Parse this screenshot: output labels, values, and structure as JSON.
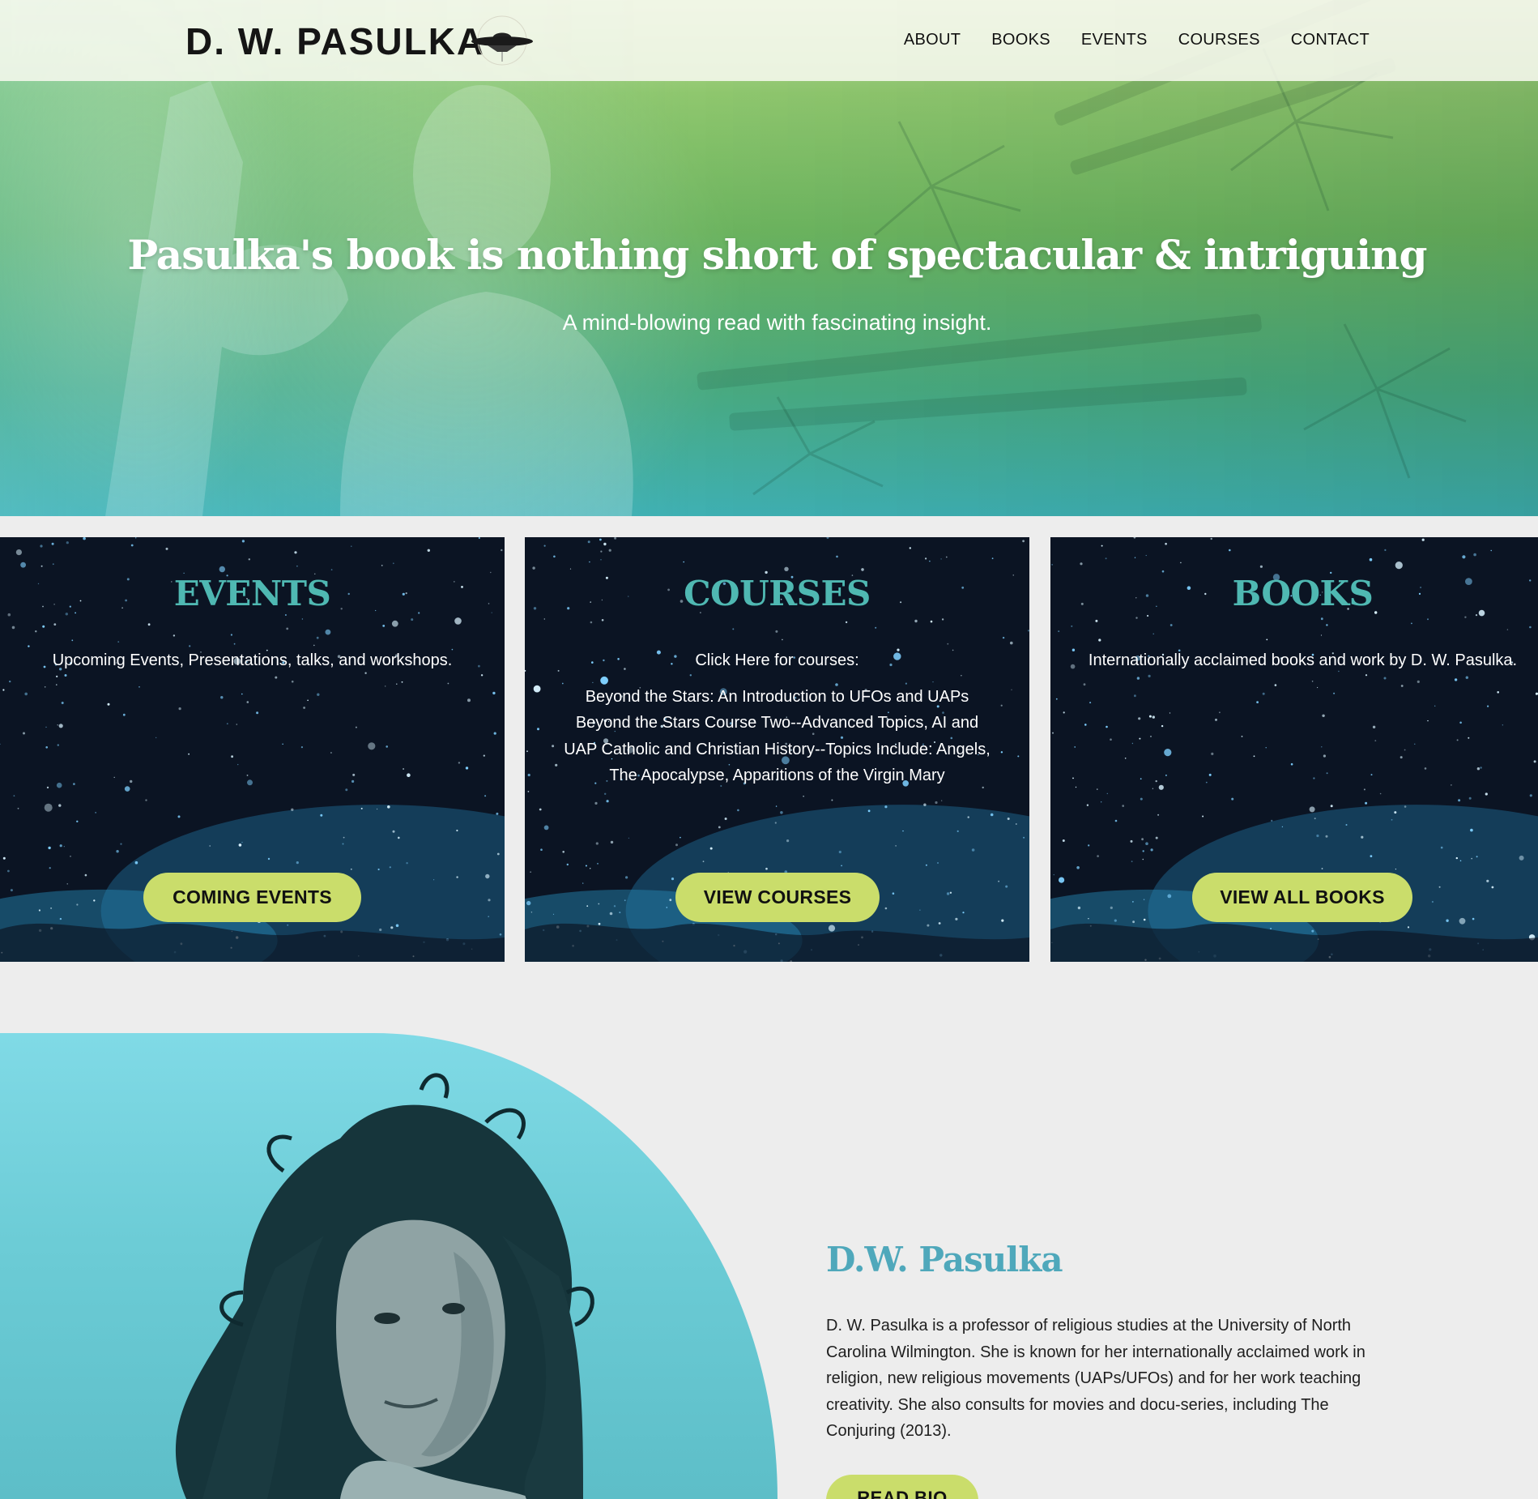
{
  "header": {
    "logo_text": "D. W. PASULKA",
    "logo_icon": "ufo-icon",
    "nav": [
      "ABOUT",
      "BOOKS",
      "EVENTS",
      "COURSES",
      "CONTACT"
    ]
  },
  "hero": {
    "title": "Pasulka's book is nothing short of spectacular & intriguing",
    "subtitle": "A mind-blowing read with fascinating insight."
  },
  "cards": [
    {
      "title": "EVENTS",
      "lines": [
        "Upcoming Events, Presentations, talks, and workshops."
      ],
      "button": "COMING EVENTS"
    },
    {
      "title": "COURSES",
      "lines": [
        "Click Here for courses:",
        "Beyond the Stars: An Introduction to UFOs and UAPs Beyond the Stars Course Two--Advanced Topics, AI and UAP Catholic and Christian History--Topics Include: Angels, The Apocalypse, Apparitions of the Virgin Mary"
      ],
      "button": "VIEW COURSES"
    },
    {
      "title": "BOOKS",
      "lines": [
        "Internationally acclaimed books and work by D. W. Pasulka."
      ],
      "button": "VIEW ALL BOOKS"
    }
  ],
  "bio": {
    "heading": "D.W. Pasulka",
    "text": "D. W. Pasulka is a professor of religious studies at the University of North Carolina Wilmington. She is known for her internationally acclaimed work in religion, new religious movements (UAPs/UFOs) and for her work teaching creativity. She also consults for movies and docu-series, including The Conjuring (2013).",
    "button": "READ BIO"
  },
  "colors": {
    "accent_teal": "#4fb8b2",
    "button_green": "#cadd6b",
    "bio_teal": "#6cccd6"
  }
}
